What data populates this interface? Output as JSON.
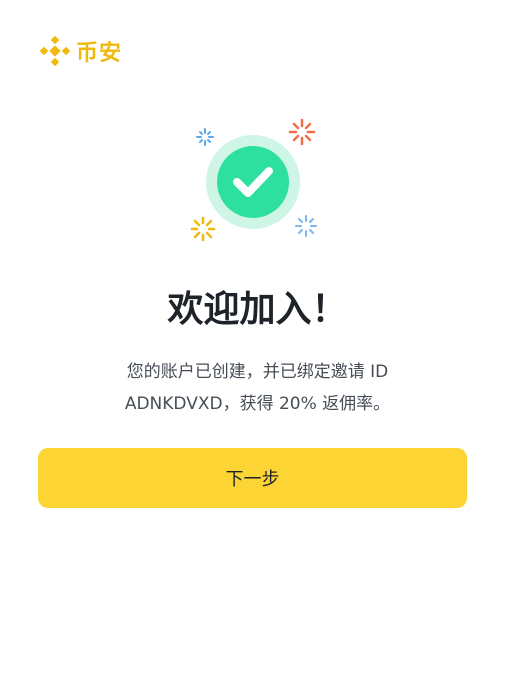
{
  "brand": {
    "name": "币安",
    "logo_icon": "binance-diamond-logo",
    "color": "#F0B90B"
  },
  "hero": {
    "icon": "success-check-icon",
    "check_color": "#2EE0A0",
    "halo_color": "#CFF5E6"
  },
  "main": {
    "title": "欢迎加入！",
    "description": "您的账户已创建，并已绑定邀请 ID ADNKDVXD，获得 20% 返佣率。"
  },
  "actions": {
    "next_label": "下一步",
    "next_color": "#FCD535"
  }
}
